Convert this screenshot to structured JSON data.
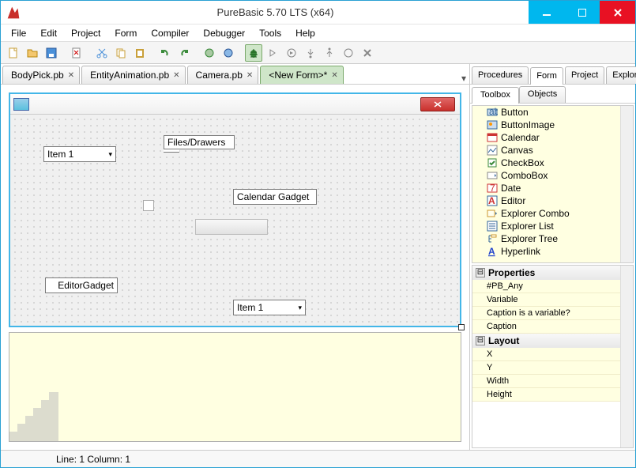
{
  "window": {
    "title": "PureBasic 5.70 LTS (x64)"
  },
  "menus": [
    "File",
    "Edit",
    "Project",
    "Form",
    "Compiler",
    "Debugger",
    "Tools",
    "Help"
  ],
  "editor_tabs": [
    {
      "label": "BodyPick.pb",
      "active": false
    },
    {
      "label": "EntityAnimation.pb",
      "active": false
    },
    {
      "label": "Camera.pb",
      "active": false
    },
    {
      "label": "<New Form>*",
      "active": true
    }
  ],
  "designer": {
    "gadgets": {
      "combo1": "Item 1",
      "files_label": "Files/Drawers",
      "calendar_label": "Calendar Gadget",
      "editor_label": "EditorGadget",
      "combo2": "Item 1"
    }
  },
  "right_tabs": [
    "Procedures",
    "Form",
    "Project",
    "Explorer"
  ],
  "right_tab_active": "Form",
  "subtabs": [
    "Toolbox",
    "Objects"
  ],
  "subtab_active": "Toolbox",
  "toolbox": [
    "Button",
    "ButtonImage",
    "Calendar",
    "Canvas",
    "CheckBox",
    "ComboBox",
    "Date",
    "Editor",
    "Explorer Combo",
    "Explorer List",
    "Explorer Tree",
    "Hyperlink"
  ],
  "properties": {
    "section1": "Properties",
    "rows1": [
      "#PB_Any",
      "Variable",
      "Caption is a variable?",
      "Caption"
    ],
    "section2": "Layout",
    "rows2": [
      "X",
      "Y",
      "Width",
      "Height"
    ]
  },
  "status": {
    "line_col": "Line: 1  Column: 1"
  }
}
